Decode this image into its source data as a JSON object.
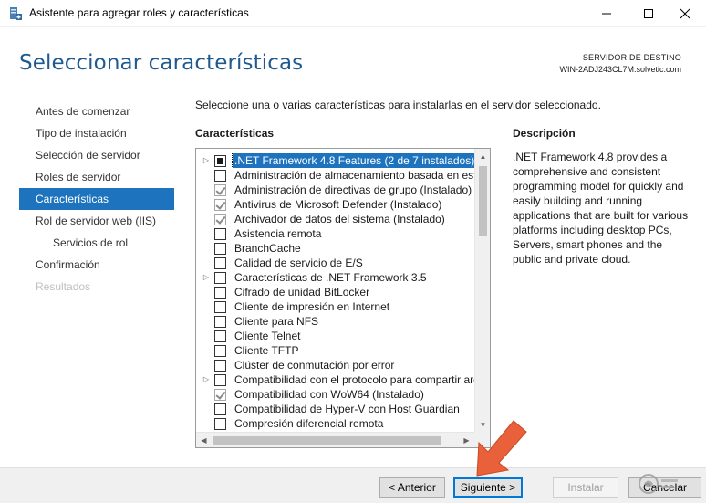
{
  "window": {
    "title": "Asistente para agregar roles y características",
    "icon": "server-manager-icon"
  },
  "header": {
    "title": "Seleccionar características",
    "server_label": "SERVIDOR DE DESTINO",
    "server_name": "WIN-2ADJ243CL7M.solvetic.com"
  },
  "nav": {
    "items": [
      {
        "label": "Antes de comenzar",
        "state": "normal"
      },
      {
        "label": "Tipo de instalación",
        "state": "normal"
      },
      {
        "label": "Selección de servidor",
        "state": "normal"
      },
      {
        "label": "Roles de servidor",
        "state": "normal"
      },
      {
        "label": "Características",
        "state": "active"
      },
      {
        "label": "Rol de servidor web (IIS)",
        "state": "normal"
      },
      {
        "label": "Servicios de rol",
        "state": "sub"
      },
      {
        "label": "Confirmación",
        "state": "normal"
      },
      {
        "label": "Resultados",
        "state": "disabled"
      }
    ]
  },
  "main": {
    "instruction": "Seleccione una o varias características para instalarlas en el servidor seleccionado.",
    "features_heading": "Características",
    "description_heading": "Descripción",
    "description_text": ".NET Framework 4.8 provides a comprehensive and consistent programming model for quickly and easily building and running applications that are built for various platforms including desktop PCs, Servers, smart phones and the public and private cloud.",
    "features": [
      {
        "label": ".NET Framework 4.8 Features (2 de 7 instalados)",
        "state": "partial",
        "expandable": true,
        "selected": true
      },
      {
        "label": "Administración de almacenamiento basada en están",
        "state": "unchecked",
        "expandable": false,
        "selected": false
      },
      {
        "label": "Administración de directivas de grupo (Instalado)",
        "state": "checked",
        "expandable": false,
        "selected": false
      },
      {
        "label": "Antivirus de Microsoft Defender (Instalado)",
        "state": "checked",
        "expandable": false,
        "selected": false
      },
      {
        "label": "Archivador de datos del sistema (Instalado)",
        "state": "checked",
        "expandable": false,
        "selected": false
      },
      {
        "label": "Asistencia remota",
        "state": "unchecked",
        "expandable": false,
        "selected": false
      },
      {
        "label": "BranchCache",
        "state": "unchecked",
        "expandable": false,
        "selected": false
      },
      {
        "label": "Calidad de servicio de E/S",
        "state": "unchecked",
        "expandable": false,
        "selected": false
      },
      {
        "label": "Características de .NET Framework 3.5",
        "state": "unchecked",
        "expandable": true,
        "selected": false
      },
      {
        "label": "Cifrado de unidad BitLocker",
        "state": "unchecked",
        "expandable": false,
        "selected": false
      },
      {
        "label": "Cliente de impresión en Internet",
        "state": "unchecked",
        "expandable": false,
        "selected": false
      },
      {
        "label": "Cliente para NFS",
        "state": "unchecked",
        "expandable": false,
        "selected": false
      },
      {
        "label": "Cliente Telnet",
        "state": "unchecked",
        "expandable": false,
        "selected": false
      },
      {
        "label": "Cliente TFTP",
        "state": "unchecked",
        "expandable": false,
        "selected": false
      },
      {
        "label": "Clúster de conmutación por error",
        "state": "unchecked",
        "expandable": false,
        "selected": false
      },
      {
        "label": "Compatibilidad con el protocolo para compartir arc",
        "state": "unchecked",
        "expandable": true,
        "selected": false
      },
      {
        "label": "Compatibilidad con WoW64 (Instalado)",
        "state": "checked",
        "expandable": false,
        "selected": false
      },
      {
        "label": "Compatibilidad de Hyper-V con Host Guardian",
        "state": "unchecked",
        "expandable": false,
        "selected": false
      },
      {
        "label": "Compresión diferencial remota",
        "state": "unchecked",
        "expandable": false,
        "selected": false
      }
    ]
  },
  "footer": {
    "prev_label": "< Anterior",
    "next_label": "Siguiente >",
    "install_label": "Instalar",
    "cancel_label": "Cancelar"
  },
  "colors": {
    "accent": "#1e73be",
    "title_blue": "#1f5a8f",
    "pointer": "#e8613a"
  }
}
